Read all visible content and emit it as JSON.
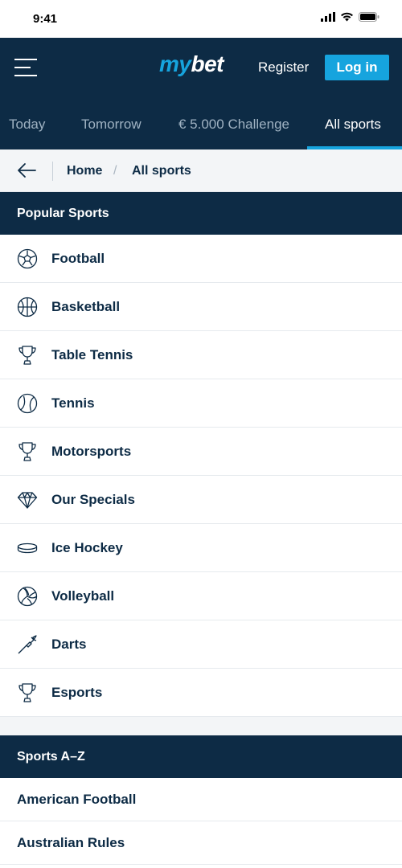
{
  "status_bar": {
    "time": "9:41"
  },
  "header": {
    "logo_prefix": "my",
    "logo_suffix": "bet",
    "register_label": "Register",
    "login_label": "Log in",
    "brand_color": "#16a4de",
    "navy_color": "#0d2b45"
  },
  "tabs": [
    {
      "label": "Today",
      "active": false
    },
    {
      "label": "Tomorrow",
      "active": false
    },
    {
      "label": "€ 5.000 Challenge",
      "active": false
    },
    {
      "label": "All sports",
      "active": true
    }
  ],
  "breadcrumb": {
    "home": "Home",
    "separator": "/",
    "current": "All sports"
  },
  "popular": {
    "title": "Popular Sports",
    "items": [
      {
        "label": "Football",
        "icon": "football-icon"
      },
      {
        "label": "Basketball",
        "icon": "basketball-icon"
      },
      {
        "label": "Table Tennis",
        "icon": "trophy-icon"
      },
      {
        "label": "Tennis",
        "icon": "tennis-ball-icon"
      },
      {
        "label": "Motorsports",
        "icon": "trophy-icon"
      },
      {
        "label": "Our Specials",
        "icon": "diamond-icon"
      },
      {
        "label": "Ice Hockey",
        "icon": "hockey-puck-icon"
      },
      {
        "label": "Volleyball",
        "icon": "volleyball-icon"
      },
      {
        "label": "Darts",
        "icon": "dart-icon"
      },
      {
        "label": "Esports",
        "icon": "trophy-icon"
      }
    ]
  },
  "az": {
    "title": "Sports A–Z",
    "items": [
      {
        "label": "American Football"
      },
      {
        "label": "Australian Rules"
      }
    ]
  }
}
